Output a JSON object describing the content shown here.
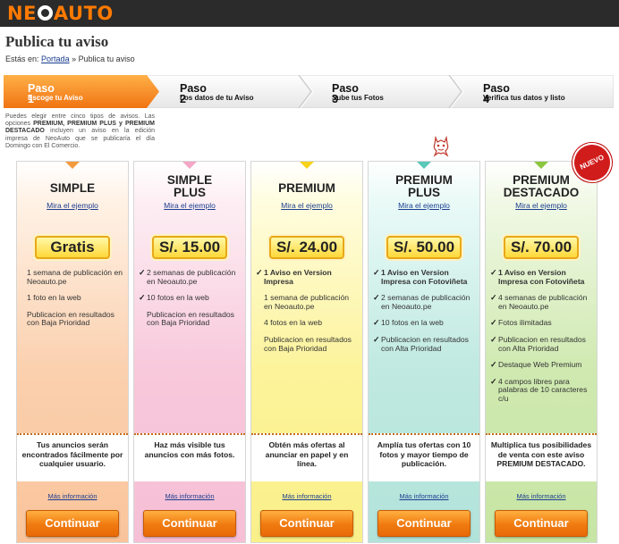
{
  "header": {
    "logo_text_1": "NE",
    "logo_text_2": "AUTO"
  },
  "page": {
    "title": "Publica tu aviso"
  },
  "breadcrumb": {
    "prefix": "Estás en:",
    "home": "Portada",
    "sep": "»",
    "current": "Publica tu aviso"
  },
  "steps": [
    {
      "title": "Paso 1",
      "sub": "Escoge tu Aviso"
    },
    {
      "title": "Paso 2",
      "sub": "Los datos de tu Aviso"
    },
    {
      "title": "Paso 3",
      "sub": "Sube tus Fotos"
    },
    {
      "title": "Paso 4",
      "sub": "Verifica tus datos y listo"
    }
  ],
  "intro": {
    "text_1": "Puedes elegir entre cinco tipos de avisos. Las opciones ",
    "strong": "PREMIUM, PREMIUM PLUS y PREMIUM DESTACADO",
    "text_2": " incluyen un aviso en la edición impresa de NeoAuto que se publicaría el día Domingo con El Comercio."
  },
  "badge": "NUEVO",
  "common": {
    "example": "Mira el ejemplo",
    "more": "Más información",
    "button": "Continuar"
  },
  "plans": [
    {
      "name_1": "SIMPLE",
      "name_2": "",
      "price": "Gratis",
      "features": [
        "1 semana de publicación en Neoauto.pe",
        "1 foto en la web",
        "Publicacion en resultados con Baja Prioridad"
      ],
      "highlight": "Tus anuncios serán encontrados fácilmente por cualquier usuario."
    },
    {
      "name_1": "SIMPLE",
      "name_2": "PLUS",
      "price": "S/. 15.00",
      "features": [
        "2 semanas de publicación en Neoauto.pe",
        "10 fotos en la web",
        "Publicacion en resultados con Baja Prioridad"
      ],
      "highlight": "Haz más visible tus anuncios con más fotos."
    },
    {
      "name_1": "PREMIUM",
      "name_2": "",
      "price": "S/. 24.00",
      "features": [
        "1 Aviso en Version Impresa",
        "1 semana de publicación en Neoauto.pe",
        "4 fotos en la web",
        "Publicacion en resultados con Baja Prioridad"
      ],
      "highlight": "Obtén más ofertas al anunciar en papel y en línea."
    },
    {
      "name_1": "PREMIUM",
      "name_2": "PLUS",
      "price": "S/. 50.00",
      "features": [
        "1 Aviso en Version Impresa con Fotoviñeta",
        "2 semanas de publicación en Neoauto.pe",
        "10 fotos en la web",
        "Publicacion en resultados con Alta Prioridad"
      ],
      "highlight": "Amplía tus ofertas con 10 fotos y mayor tiempo de publicación."
    },
    {
      "name_1": "PREMIUM",
      "name_2": "DESTACADO",
      "price": "S/. 70.00",
      "features": [
        "1 Aviso en Version Impresa con Fotoviñeta",
        "4 semanas de publicación en Neoauto.pe",
        "Fotos ilimitadas",
        "Publicacion en resultados con Alta Prioridad",
        "Destaque Web Premium",
        "4 campos libres para palabras de 10 caracteres c/u"
      ],
      "highlight": "Multiplica tus posibilidades de venta con este aviso PREMIUM DESTACADO."
    }
  ],
  "colors": {
    "accent": "#f07a10",
    "tab_colors": [
      "#f39a3c",
      "#f4a6c6",
      "#f7d21a",
      "#5bc8b8",
      "#8cc63f"
    ]
  }
}
